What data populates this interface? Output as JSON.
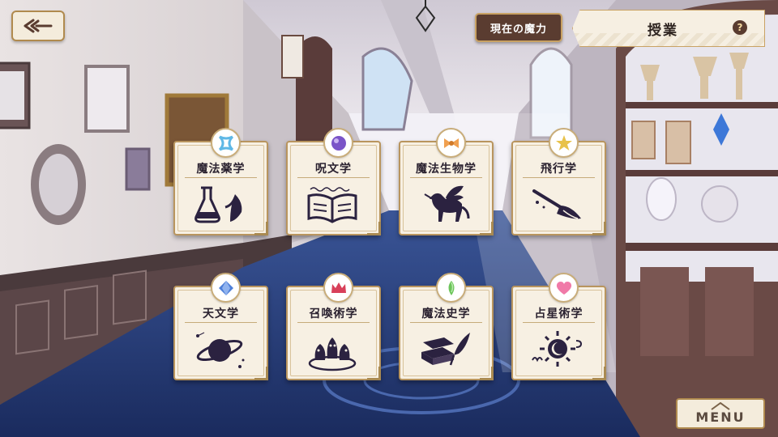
{
  "header": {
    "back_icon": "back-arrow-icon",
    "magic_button_label": "現在の魔力",
    "screen_title": "授業",
    "help_symbol": "?"
  },
  "subjects": [
    {
      "label": "魔法薬学",
      "badge_icon": "blue-ribbon-icon",
      "badge_color": "#5fb8e6",
      "pictogram": "flask-and-leaf-icon"
    },
    {
      "label": "呪文学",
      "badge_icon": "purple-orb-icon",
      "badge_color": "#7a54c8",
      "pictogram": "open-spellbook-icon"
    },
    {
      "label": "魔法生物学",
      "badge_icon": "orange-bow-icon",
      "badge_color": "#f0a050",
      "pictogram": "winged-unicorn-icon"
    },
    {
      "label": "飛行学",
      "badge_icon": "gold-star-icon",
      "badge_color": "#e8c24a",
      "pictogram": "broomstick-icon"
    },
    {
      "label": "天文学",
      "badge_icon": "blue-gem-icon",
      "badge_color": "#4d7fd8",
      "pictogram": "ringed-planet-icon"
    },
    {
      "label": "召喚術学",
      "badge_icon": "red-crown-icon",
      "badge_color": "#d8405a",
      "pictogram": "summoning-circle-icon"
    },
    {
      "label": "魔法史学",
      "badge_icon": "green-crystal-icon",
      "badge_color": "#6cc45a",
      "pictogram": "books-and-quill-icon"
    },
    {
      "label": "占星術学",
      "badge_icon": "pink-heart-icon",
      "badge_color": "#f07aa8",
      "pictogram": "sun-and-zodiac-icon"
    }
  ],
  "footer": {
    "menu_label": "MENU",
    "menu_icon": "roof-icon"
  },
  "colors": {
    "corridor_carpet": "#233a78",
    "card_bg": "#f7f0e3",
    "card_border": "#b9955e",
    "accent_dark": "#5a3c30"
  }
}
